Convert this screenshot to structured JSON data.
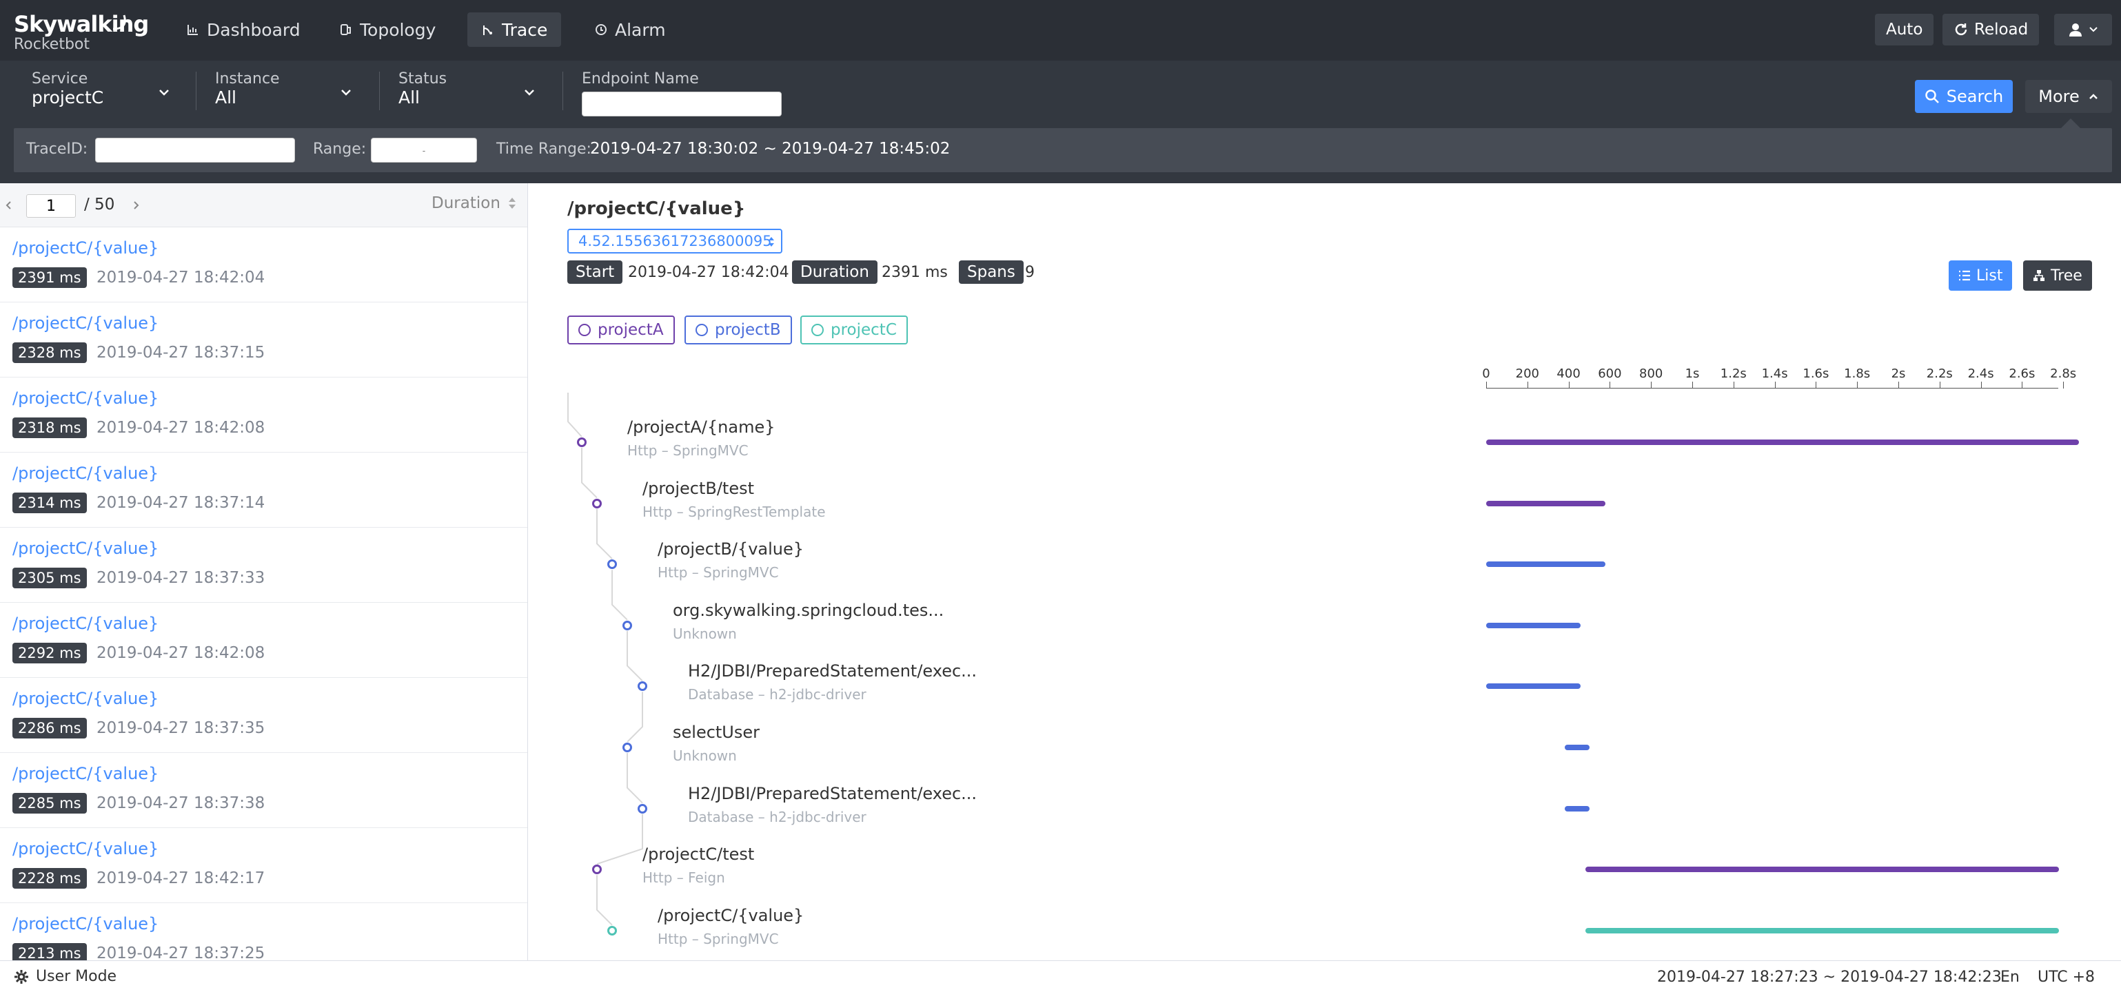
{
  "brand": {
    "name": "Skywalking",
    "sub": "Rocketbot"
  },
  "nav": [
    {
      "label": "Dashboard",
      "icon": "chart-icon"
    },
    {
      "label": "Topology",
      "icon": "topology-icon"
    },
    {
      "label": "Trace",
      "icon": "trace-icon",
      "active": true
    },
    {
      "label": "Alarm",
      "icon": "alarm-icon"
    }
  ],
  "top_actions": {
    "auto": "Auto",
    "reload": "Reload"
  },
  "filters": {
    "service": {
      "label": "Service",
      "value": "projectC"
    },
    "instance": {
      "label": "Instance",
      "value": "All"
    },
    "status": {
      "label": "Status",
      "value": "All"
    },
    "endpoint": {
      "label": "Endpoint Name",
      "value": ""
    },
    "search": "Search",
    "more": "More",
    "trace_id_label": "TraceID:",
    "range_label": "Range:",
    "range_placeholder": "-",
    "time_range_label": "Time Range:",
    "time_range_value": "2019-04-27 18:30:02 ~ 2019-04-27 18:45:02"
  },
  "pager": {
    "page": "1",
    "total": "/ 50",
    "sort": "Duration"
  },
  "traces": [
    {
      "title": "/projectC/{value}",
      "duration": "2391 ms",
      "time": "2019-04-27 18:42:04"
    },
    {
      "title": "/projectC/{value}",
      "duration": "2328 ms",
      "time": "2019-04-27 18:37:15"
    },
    {
      "title": "/projectC/{value}",
      "duration": "2318 ms",
      "time": "2019-04-27 18:42:08"
    },
    {
      "title": "/projectC/{value}",
      "duration": "2314 ms",
      "time": "2019-04-27 18:37:14"
    },
    {
      "title": "/projectC/{value}",
      "duration": "2305 ms",
      "time": "2019-04-27 18:37:33"
    },
    {
      "title": "/projectC/{value}",
      "duration": "2292 ms",
      "time": "2019-04-27 18:42:08"
    },
    {
      "title": "/projectC/{value}",
      "duration": "2286 ms",
      "time": "2019-04-27 18:37:35"
    },
    {
      "title": "/projectC/{value}",
      "duration": "2285 ms",
      "time": "2019-04-27 18:37:38"
    },
    {
      "title": "/projectC/{value}",
      "duration": "2228 ms",
      "time": "2019-04-27 18:42:17"
    },
    {
      "title": "/projectC/{value}",
      "duration": "2213 ms",
      "time": "2019-04-27 18:37:25"
    }
  ],
  "detail": {
    "title": "/projectC/{value}",
    "trace_id": "4.52.15563617236800095",
    "start_label": "Start",
    "start_value": "2019-04-27 18:42:04",
    "duration_label": "Duration",
    "duration_value": "2391 ms",
    "spans_label": "Spans",
    "spans_value": "9",
    "view_list": "List",
    "view_tree": "Tree",
    "services": [
      {
        "name": "projectA",
        "color": "#6e40aa"
      },
      {
        "name": "projectB",
        "color": "#4c6edb"
      },
      {
        "name": "projectC",
        "color": "#4ec3b4"
      }
    ],
    "ticks": [
      "0",
      "200",
      "400",
      "600",
      "800",
      "1s",
      "1.2s",
      "1.4s",
      "1.6s",
      "1.8s",
      "2s",
      "2.2s",
      "2.4s",
      "2.6s",
      "2.8s"
    ],
    "spans": [
      {
        "name": "/projectA/{name}",
        "sub": "Http – SpringMVC",
        "depth": 0,
        "color": "#6e40aa",
        "start": 0,
        "end": 2391
      },
      {
        "name": "/projectB/test",
        "sub": "Http – SpringRestTemplate",
        "depth": 1,
        "color": "#6e40aa",
        "start": 0,
        "end": 480
      },
      {
        "name": "/projectB/{value}",
        "sub": "Http – SpringMVC",
        "depth": 2,
        "color": "#4c6edb",
        "start": 0,
        "end": 480
      },
      {
        "name": "org.skywalking.springcloud.tes...",
        "sub": "Unknown",
        "depth": 3,
        "color": "#4c6edb",
        "start": 0,
        "end": 380
      },
      {
        "name": "H2/JDBI/PreparedStatement/exec...",
        "sub": "Database – h2-jdbc-driver",
        "depth": 4,
        "color": "#4c6edb",
        "start": 0,
        "end": 380
      },
      {
        "name": "selectUser",
        "sub": "Unknown",
        "depth": 3,
        "color": "#4c6edb",
        "start": 380,
        "end": 480
      },
      {
        "name": "H2/JDBI/PreparedStatement/exec...",
        "sub": "Database – h2-jdbc-driver",
        "depth": 4,
        "color": "#4c6edb",
        "start": 380,
        "end": 480
      },
      {
        "name": "/projectC/test",
        "sub": "Http – Feign",
        "depth": 1,
        "color": "#6e40aa",
        "start": 480,
        "end": 2391
      },
      {
        "name": "/projectC/{value}",
        "sub": "Http – SpringMVC",
        "depth": 2,
        "color": "#4ec3b4",
        "start": 480,
        "end": 2391
      }
    ]
  },
  "footer": {
    "user_mode": "User Mode",
    "time_range": "2019-04-27 18:27:23 ~ 2019-04-27 18:42:23",
    "lang": "En",
    "tz": "UTC +8"
  }
}
